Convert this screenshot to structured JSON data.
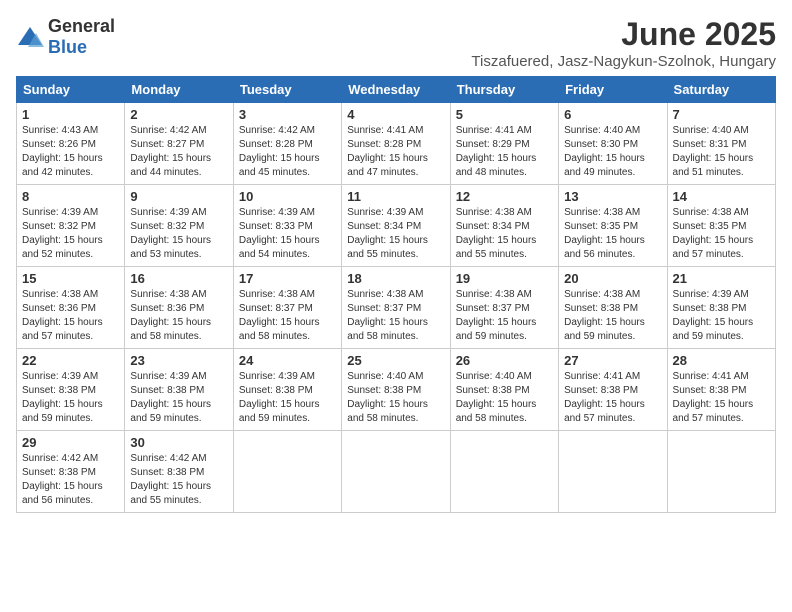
{
  "logo": {
    "general": "General",
    "blue": "Blue"
  },
  "header": {
    "month": "June 2025",
    "location": "Tiszafuered, Jasz-Nagykun-Szolnok, Hungary"
  },
  "weekdays": [
    "Sunday",
    "Monday",
    "Tuesday",
    "Wednesday",
    "Thursday",
    "Friday",
    "Saturday"
  ],
  "weeks": [
    [
      {
        "day": "1",
        "sunrise": "4:43 AM",
        "sunset": "8:26 PM",
        "daylight": "15 hours and 42 minutes."
      },
      {
        "day": "2",
        "sunrise": "4:42 AM",
        "sunset": "8:27 PM",
        "daylight": "15 hours and 44 minutes."
      },
      {
        "day": "3",
        "sunrise": "4:42 AM",
        "sunset": "8:28 PM",
        "daylight": "15 hours and 45 minutes."
      },
      {
        "day": "4",
        "sunrise": "4:41 AM",
        "sunset": "8:28 PM",
        "daylight": "15 hours and 47 minutes."
      },
      {
        "day": "5",
        "sunrise": "4:41 AM",
        "sunset": "8:29 PM",
        "daylight": "15 hours and 48 minutes."
      },
      {
        "day": "6",
        "sunrise": "4:40 AM",
        "sunset": "8:30 PM",
        "daylight": "15 hours and 49 minutes."
      },
      {
        "day": "7",
        "sunrise": "4:40 AM",
        "sunset": "8:31 PM",
        "daylight": "15 hours and 51 minutes."
      }
    ],
    [
      {
        "day": "8",
        "sunrise": "4:39 AM",
        "sunset": "8:32 PM",
        "daylight": "15 hours and 52 minutes."
      },
      {
        "day": "9",
        "sunrise": "4:39 AM",
        "sunset": "8:32 PM",
        "daylight": "15 hours and 53 minutes."
      },
      {
        "day": "10",
        "sunrise": "4:39 AM",
        "sunset": "8:33 PM",
        "daylight": "15 hours and 54 minutes."
      },
      {
        "day": "11",
        "sunrise": "4:39 AM",
        "sunset": "8:34 PM",
        "daylight": "15 hours and 55 minutes."
      },
      {
        "day": "12",
        "sunrise": "4:38 AM",
        "sunset": "8:34 PM",
        "daylight": "15 hours and 55 minutes."
      },
      {
        "day": "13",
        "sunrise": "4:38 AM",
        "sunset": "8:35 PM",
        "daylight": "15 hours and 56 minutes."
      },
      {
        "day": "14",
        "sunrise": "4:38 AM",
        "sunset": "8:35 PM",
        "daylight": "15 hours and 57 minutes."
      }
    ],
    [
      {
        "day": "15",
        "sunrise": "4:38 AM",
        "sunset": "8:36 PM",
        "daylight": "15 hours and 57 minutes."
      },
      {
        "day": "16",
        "sunrise": "4:38 AM",
        "sunset": "8:36 PM",
        "daylight": "15 hours and 58 minutes."
      },
      {
        "day": "17",
        "sunrise": "4:38 AM",
        "sunset": "8:37 PM",
        "daylight": "15 hours and 58 minutes."
      },
      {
        "day": "18",
        "sunrise": "4:38 AM",
        "sunset": "8:37 PM",
        "daylight": "15 hours and 58 minutes."
      },
      {
        "day": "19",
        "sunrise": "4:38 AM",
        "sunset": "8:37 PM",
        "daylight": "15 hours and 59 minutes."
      },
      {
        "day": "20",
        "sunrise": "4:38 AM",
        "sunset": "8:38 PM",
        "daylight": "15 hours and 59 minutes."
      },
      {
        "day": "21",
        "sunrise": "4:39 AM",
        "sunset": "8:38 PM",
        "daylight": "15 hours and 59 minutes."
      }
    ],
    [
      {
        "day": "22",
        "sunrise": "4:39 AM",
        "sunset": "8:38 PM",
        "daylight": "15 hours and 59 minutes."
      },
      {
        "day": "23",
        "sunrise": "4:39 AM",
        "sunset": "8:38 PM",
        "daylight": "15 hours and 59 minutes."
      },
      {
        "day": "24",
        "sunrise": "4:39 AM",
        "sunset": "8:38 PM",
        "daylight": "15 hours and 59 minutes."
      },
      {
        "day": "25",
        "sunrise": "4:40 AM",
        "sunset": "8:38 PM",
        "daylight": "15 hours and 58 minutes."
      },
      {
        "day": "26",
        "sunrise": "4:40 AM",
        "sunset": "8:38 PM",
        "daylight": "15 hours and 58 minutes."
      },
      {
        "day": "27",
        "sunrise": "4:41 AM",
        "sunset": "8:38 PM",
        "daylight": "15 hours and 57 minutes."
      },
      {
        "day": "28",
        "sunrise": "4:41 AM",
        "sunset": "8:38 PM",
        "daylight": "15 hours and 57 minutes."
      }
    ],
    [
      {
        "day": "29",
        "sunrise": "4:42 AM",
        "sunset": "8:38 PM",
        "daylight": "15 hours and 56 minutes."
      },
      {
        "day": "30",
        "sunrise": "4:42 AM",
        "sunset": "8:38 PM",
        "daylight": "15 hours and 55 minutes."
      },
      null,
      null,
      null,
      null,
      null
    ]
  ]
}
